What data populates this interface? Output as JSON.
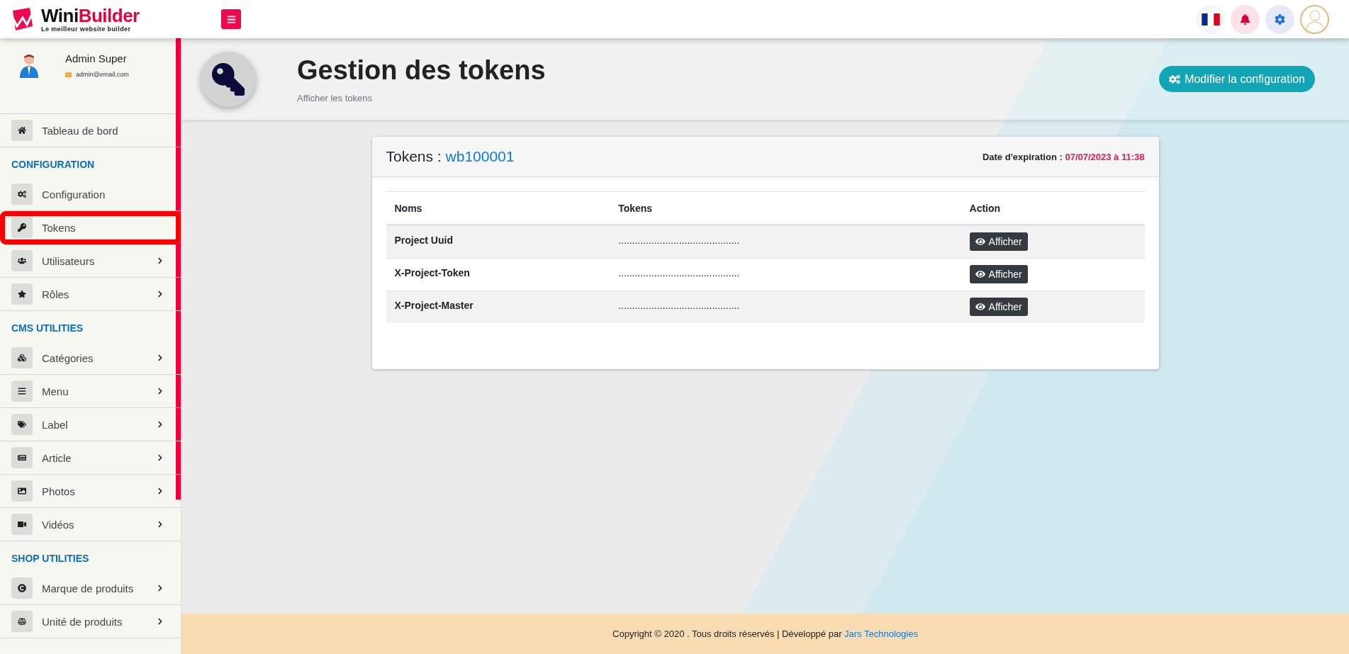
{
  "header": {
    "logo": {
      "name_first": "Wini",
      "name_second": "Builder",
      "tagline": "Le meilleur website builder"
    }
  },
  "sidebar": {
    "user": {
      "name": "Admin Super",
      "email": "admin@email.com"
    },
    "items": [
      {
        "kind": "link",
        "label": "Tableau de bord",
        "has_submenu": false,
        "highlighted": false
      },
      {
        "kind": "heading",
        "label": "CONFIGURATION"
      },
      {
        "kind": "link",
        "label": "Configuration",
        "has_submenu": false,
        "highlighted": false
      },
      {
        "kind": "link",
        "label": "Tokens",
        "has_submenu": false,
        "highlighted": true
      },
      {
        "kind": "link",
        "label": "Utilisateurs",
        "has_submenu": true,
        "highlighted": false
      },
      {
        "kind": "link",
        "label": "Rôles",
        "has_submenu": true,
        "highlighted": false
      },
      {
        "kind": "heading",
        "label": "CMS UTILITIES"
      },
      {
        "kind": "link",
        "label": "Catégories",
        "has_submenu": true,
        "highlighted": false
      },
      {
        "kind": "link",
        "label": "Menu",
        "has_submenu": true,
        "highlighted": false
      },
      {
        "kind": "link",
        "label": "Label",
        "has_submenu": true,
        "highlighted": false
      },
      {
        "kind": "link",
        "label": "Article",
        "has_submenu": true,
        "highlighted": false
      },
      {
        "kind": "link",
        "label": "Photos",
        "has_submenu": true,
        "highlighted": false
      },
      {
        "kind": "link",
        "label": "Vidéos",
        "has_submenu": true,
        "highlighted": false
      },
      {
        "kind": "heading",
        "label": "SHOP UTILITIES"
      },
      {
        "kind": "link",
        "label": "Marque de produits",
        "has_submenu": true,
        "highlighted": false
      },
      {
        "kind": "link",
        "label": "Unité de produits",
        "has_submenu": true,
        "highlighted": false
      }
    ]
  },
  "page_header": {
    "title": "Gestion des tokens",
    "subtitle": "Afficher les tokens",
    "button": "Modifier la configuration"
  },
  "card": {
    "title": "Tokens :",
    "project_id": "wb100001",
    "expiry_label": "Date d'expiration :",
    "expiry_value": "07/07/2023 à 11:38",
    "table": {
      "columns": [
        "Noms",
        "Tokens",
        "Action"
      ],
      "rows": [
        {
          "name": "Project Uuid",
          "token": "............................................",
          "action": "Afficher"
        },
        {
          "name": "X-Project-Token",
          "token": "............................................",
          "action": "Afficher"
        },
        {
          "name": "X-Project-Master",
          "token": "............................................",
          "action": "Afficher"
        }
      ]
    }
  },
  "footer": {
    "text": "Copyright © 2020 . Tous droits réservés | Développé par ",
    "link": "Jars Technologies"
  }
}
